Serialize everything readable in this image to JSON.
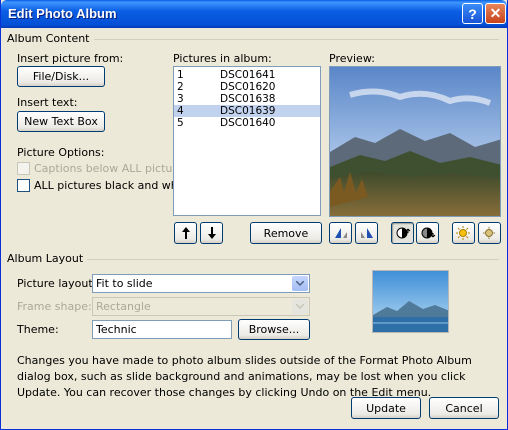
{
  "window": {
    "title": "Edit Photo Album",
    "help_glyph": "?",
    "close_glyph": "✕"
  },
  "album_content": {
    "group_title": "Album Content",
    "insert_picture_label": "Insert picture from:",
    "file_disk_button": "File/Disk...",
    "insert_text_label": "Insert text:",
    "new_text_box_button": "New Text Box",
    "picture_options_label": "Picture Options:",
    "captions_option": {
      "label": "Captions below ALL pictures",
      "checked": false,
      "enabled": false
    },
    "bw_option": {
      "label": "ALL pictures black and white",
      "checked": false,
      "enabled": true
    },
    "pictures_label": "Pictures in album:",
    "pictures": [
      {
        "num": "1",
        "name": "DSC01641",
        "selected": false
      },
      {
        "num": "2",
        "name": "DSC01620",
        "selected": false
      },
      {
        "num": "3",
        "name": "DSC01638",
        "selected": false
      },
      {
        "num": "4",
        "name": "DSC01639",
        "selected": true
      },
      {
        "num": "5",
        "name": "DSC01640",
        "selected": false
      }
    ],
    "remove_button": "Remove",
    "preview_label": "Preview:"
  },
  "album_layout": {
    "group_title": "Album Layout",
    "picture_layout_label": "Picture layout:",
    "picture_layout_value": "Fit to slide",
    "frame_shape_label": "Frame shape:",
    "frame_shape_value": "Rectangle",
    "theme_label": "Theme:",
    "theme_value": "Technic",
    "browse_button": "Browse..."
  },
  "note": "Changes you have made to photo album slides outside of the Format Photo Album dialog box, such as slide background and animations, may be lost when you click Update. You can recover those changes by clicking Undo on the Edit menu.",
  "footer": {
    "update_button": "Update",
    "cancel_button": "Cancel"
  },
  "colors": {
    "title_bar": "#0a5ee3",
    "selection": "#c1d2ee",
    "dialog_bg": "#ece9d8"
  }
}
